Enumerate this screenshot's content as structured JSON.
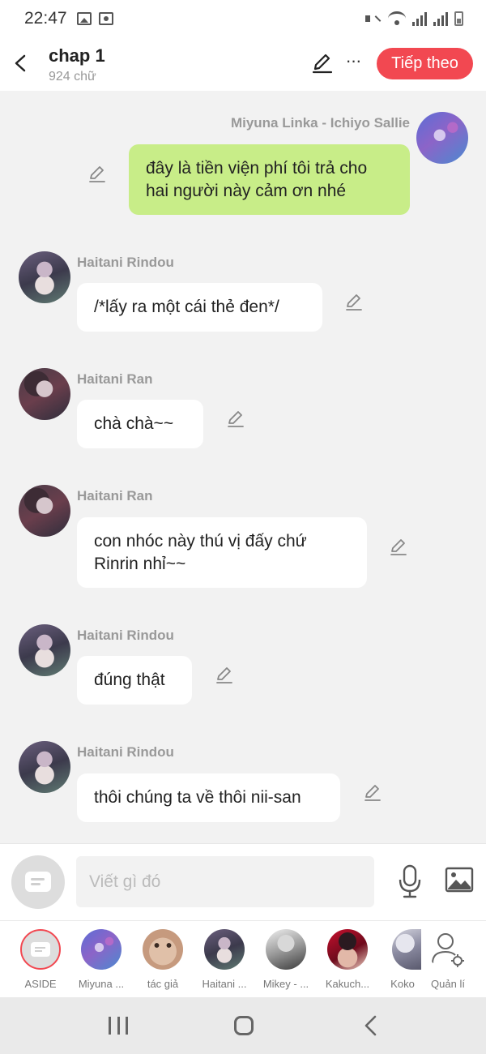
{
  "status_bar": {
    "time": "22:47"
  },
  "header": {
    "title": "chap 1",
    "word_count": "924 chữ",
    "next_button": "Tiếp theo",
    "more": "···"
  },
  "messages": [
    {
      "sender": "Miyuna Linka - Ichiyo Sallie",
      "text": "đây là tiền viện phí tôi trả cho hai người này cảm ơn nhé",
      "own": true
    },
    {
      "sender": "Haitani Rindou",
      "text": "/*lấy ra một cái thẻ đen*/",
      "own": false
    },
    {
      "sender": "Haitani Ran",
      "text": "chà chà~~",
      "own": false
    },
    {
      "sender": "Haitani Ran",
      "text": "con nhóc này thú vị đấy chứ Rinrin nhỉ~~",
      "own": false
    },
    {
      "sender": "Haitani Rindou",
      "text": "đúng thật",
      "own": false
    },
    {
      "sender": "Haitani Rindou",
      "text": "thôi chúng ta về thôi nii-san",
      "own": false
    }
  ],
  "input": {
    "placeholder": "Viết gì đó"
  },
  "characters": [
    {
      "label": "ASIDE"
    },
    {
      "label": "Miyuna ..."
    },
    {
      "label": "tác giả"
    },
    {
      "label": "Haitani ..."
    },
    {
      "label": "Mikey - ..."
    },
    {
      "label": "Kakuch..."
    },
    {
      "label": "Koko"
    },
    {
      "label": "Quản lí"
    }
  ],
  "colors": {
    "accent": "#f24851",
    "own_bubble": "#c8ed88",
    "other_bubble": "#ffffff",
    "chat_background": "#f2f2f2"
  }
}
